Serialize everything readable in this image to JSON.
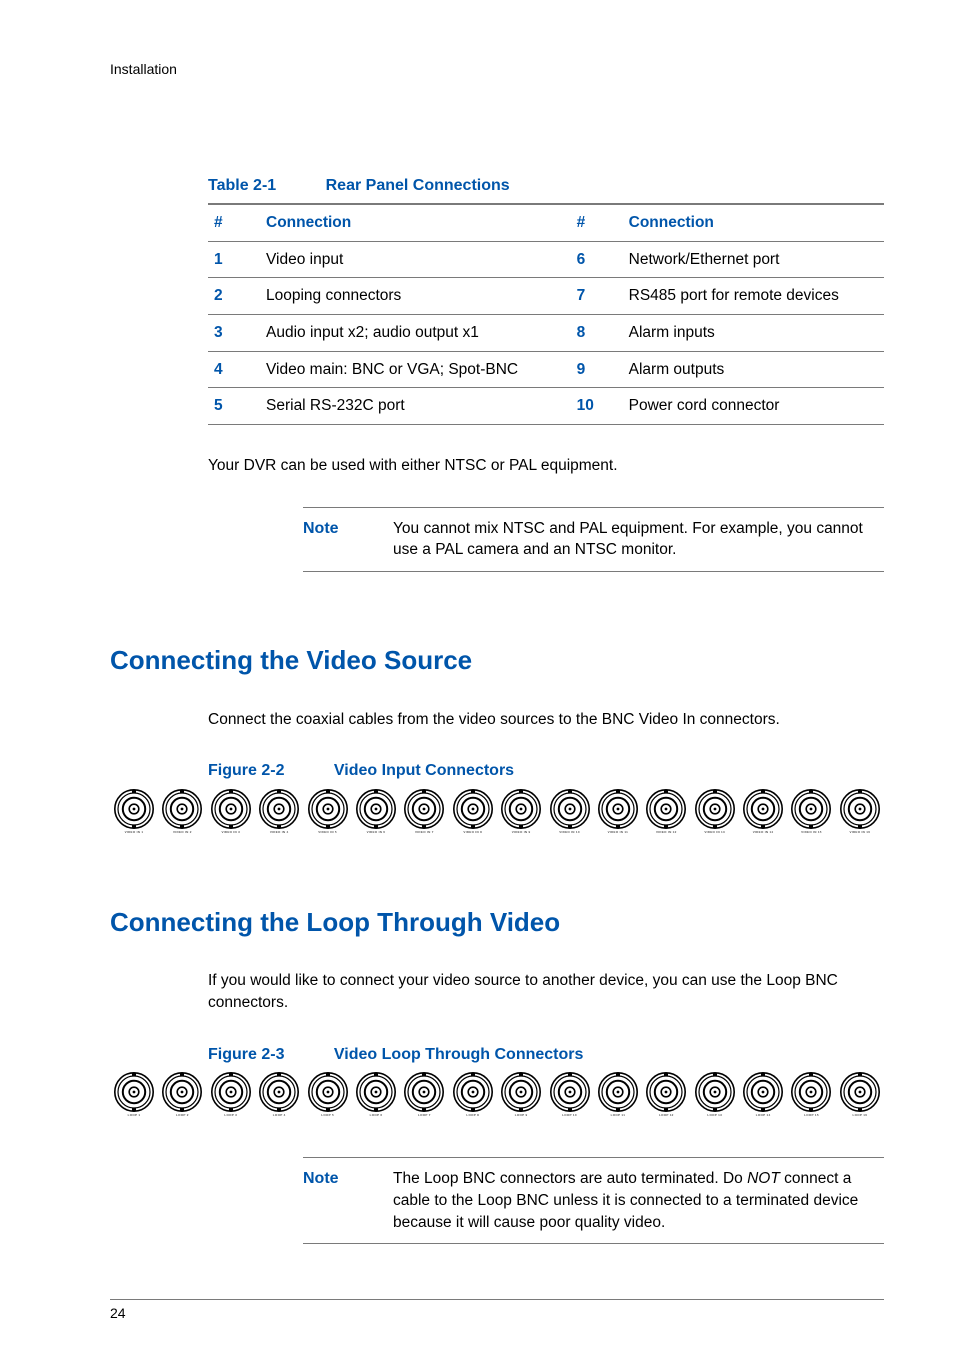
{
  "header": {
    "running": "Installation"
  },
  "table": {
    "caption_label": "Table 2-1",
    "caption_title": "Rear Panel Connections",
    "head": {
      "h1": "#",
      "h2": "Connection",
      "h3": "#",
      "h4": "Connection"
    },
    "rows": [
      {
        "n1": "1",
        "c1": "Video input",
        "n2": "6",
        "c2": "Network/Ethernet port"
      },
      {
        "n1": "2",
        "c1": "Looping connectors",
        "n2": "7",
        "c2": "RS485 port for remote devices"
      },
      {
        "n1": "3",
        "c1": "Audio input x2; audio output x1",
        "n2": "8",
        "c2": "Alarm inputs"
      },
      {
        "n1": "4",
        "c1": "Video main: BNC or VGA; Spot-BNC",
        "n2": "9",
        "c2": "Alarm outputs"
      },
      {
        "n1": "5",
        "c1": "Serial RS-232C port",
        "n2": "10",
        "c2": "Power cord connector"
      }
    ]
  },
  "para1": "Your DVR can be used with either NTSC or PAL equipment.",
  "note1": {
    "label": "Note",
    "text": "You cannot mix NTSC and PAL equipment. For example, you cannot use a PAL camera and an NTSC monitor."
  },
  "section1": {
    "title": "Connecting the Video Source",
    "para": "Connect the coaxial cables from the video sources to the BNC Video In connectors.",
    "fig_label": "Figure 2-2",
    "fig_title": "Video Input Connectors",
    "bnc_prefix": "VIDEO IN"
  },
  "section2": {
    "title": "Connecting the Loop Through Video",
    "para": "If you would like to connect your video source to another device, you can use the Loop BNC connectors.",
    "fig_label": "Figure 2-3",
    "fig_title": "Video Loop Through Connectors",
    "bnc_prefix": "LOOP"
  },
  "note2": {
    "label": "Note",
    "text_pre": "The Loop BNC connectors are auto terminated. Do ",
    "text_em": "NOT",
    "text_post": " connect a cable to the Loop BNC unless it is connected to a terminated device because it will cause poor quality video."
  },
  "footer": {
    "page": "24"
  }
}
